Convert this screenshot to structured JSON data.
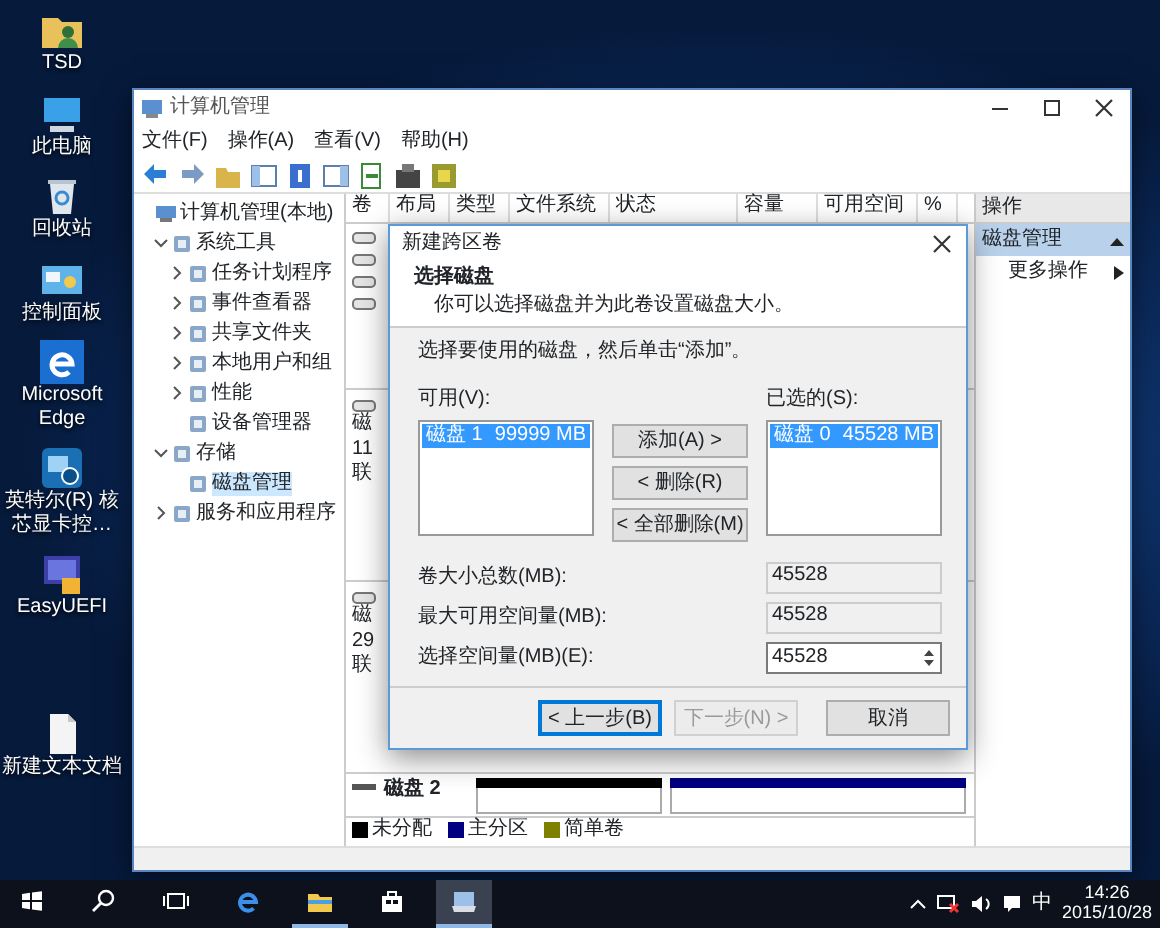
{
  "desktop_icons": [
    {
      "label": "TSD",
      "kind": "folder"
    },
    {
      "label": "此电脑",
      "kind": "computer"
    },
    {
      "label": "回收站",
      "kind": "recycle"
    },
    {
      "label": "控制面板",
      "kind": "control-panel"
    },
    {
      "label": "Microsoft Edge",
      "kind": "edge"
    },
    {
      "label": "英特尔(R) 核芯显卡控…",
      "kind": "graphics"
    },
    {
      "label": "EasyUEFI",
      "kind": "uefi"
    },
    {
      "label": "新建文本文档",
      "kind": "text-file"
    }
  ],
  "window": {
    "title": "计算机管理",
    "menu": [
      "文件(F)",
      "操作(A)",
      "查看(V)",
      "帮助(H)"
    ],
    "tree": [
      {
        "label": "计算机管理(本地)",
        "selected": false,
        "children": [
          {
            "label": "系统工具",
            "expanded": true,
            "selected": false,
            "children": [
              {
                "label": "任务计划程序",
                "expanded": false,
                "selected": false
              },
              {
                "label": "事件查看器",
                "expanded": false,
                "selected": false
              },
              {
                "label": "共享文件夹",
                "expanded": false,
                "selected": false
              },
              {
                "label": "本地用户和组",
                "expanded": false,
                "selected": false
              },
              {
                "label": "性能",
                "expanded": false,
                "selected": false
              },
              {
                "label": "设备管理器",
                "selected": false
              }
            ]
          },
          {
            "label": "存储",
            "expanded": true,
            "selected": false,
            "children": [
              {
                "label": "磁盘管理",
                "selected": true
              }
            ]
          },
          {
            "label": "服务和应用程序",
            "expanded": false,
            "selected": false
          }
        ]
      }
    ],
    "columns": [
      "卷",
      "布局",
      "类型",
      "文件系统",
      "状态",
      "容量",
      "可用空间",
      "%"
    ],
    "disk_rows": [
      {
        "lines": [
          "磁",
          "11",
          "联"
        ]
      },
      {
        "lines": [
          "磁",
          "29",
          "联"
        ]
      }
    ],
    "disk_2": {
      "label": "磁盘 2",
      "partitions": [
        {
          "kind": "unallocated",
          "color": "#000000"
        },
        {
          "kind": "primary",
          "color": "#000080"
        }
      ]
    },
    "legend": [
      {
        "label": "未分配",
        "color": "#000000"
      },
      {
        "label": "主分区",
        "color": "#000080"
      },
      {
        "label": "简单卷",
        "color": "#808000"
      }
    ],
    "actions": {
      "title": "操作",
      "section": "磁盘管理",
      "items": [
        "更多操作"
      ]
    }
  },
  "dialog": {
    "title": "新建跨区卷",
    "heading": "选择磁盘",
    "subtitle": "你可以选择磁盘并为此卷设置磁盘大小。",
    "instruction": "选择要使用的磁盘，然后单击“添加”。",
    "available": {
      "label": "可用(V):",
      "items": [
        {
          "disk": "磁盘 1",
          "size": "99999 MB",
          "selected": true
        }
      ]
    },
    "chosen": {
      "label": "已选的(S):",
      "items": [
        {
          "disk": "磁盘 0",
          "size": "45528 MB",
          "selected": true
        }
      ]
    },
    "move_buttons": [
      "添加(A) >",
      "< 删除(R)",
      "< 全部删除(M)"
    ],
    "fields": [
      {
        "label": "卷大小总数(MB):",
        "value": "45528",
        "kind": "readonly"
      },
      {
        "label": "最大可用空间量(MB):",
        "value": "45528",
        "kind": "readonly"
      },
      {
        "label": "选择空间量(MB)(E):",
        "value": "45528",
        "kind": "spin"
      }
    ],
    "buttons": [
      {
        "label": "< 上一步(B)",
        "focused": true,
        "disabled": false
      },
      {
        "label": "下一步(N) >",
        "focused": false,
        "disabled": true
      },
      {
        "label": "取消",
        "focused": false,
        "disabled": false
      }
    ]
  },
  "taskbar": {
    "items": [
      {
        "kind": "start",
        "running": false,
        "selected": false
      },
      {
        "kind": "search",
        "running": false,
        "selected": false
      },
      {
        "kind": "task-view",
        "running": false,
        "selected": false
      },
      {
        "kind": "edge",
        "running": false,
        "selected": false
      },
      {
        "kind": "explorer",
        "running": true,
        "selected": false
      },
      {
        "kind": "store",
        "running": false,
        "selected": false
      },
      {
        "kind": "computer-management",
        "running": true,
        "selected": true
      }
    ],
    "ime": "中",
    "time": "14:26",
    "date": "2015/10/28"
  }
}
